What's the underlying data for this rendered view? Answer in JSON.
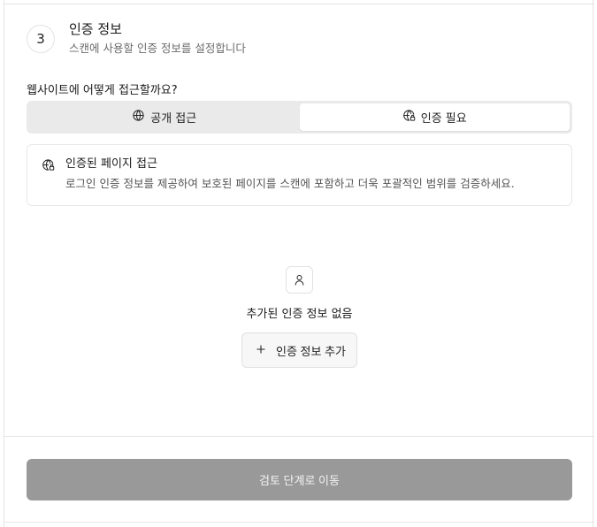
{
  "step": {
    "number": "3",
    "title": "인증 정보",
    "subtitle": "스캔에 사용할 인증 정보를 설정합니다"
  },
  "access": {
    "question": "웹사이트에 어떻게 접근할까요?",
    "options": [
      {
        "label": "공개 접근",
        "icon": "globe-icon",
        "selected": false
      },
      {
        "label": "인증 필요",
        "icon": "globe-lock-icon",
        "selected": true
      }
    ]
  },
  "info": {
    "icon": "globe-lock-icon",
    "title": "인증된 페이지 접근",
    "description": "로그인 인증 정보를 제공하여 보호된 페이지를 스캔에 포함하고 더욱 포괄적인 범위를 검증하세요."
  },
  "credentials": {
    "empty_icon": "user-icon",
    "empty_title": "추가된 인증 정보 없음",
    "add_label": "인증 정보 추가"
  },
  "footer": {
    "next_label": "검토 단계로 이동"
  }
}
